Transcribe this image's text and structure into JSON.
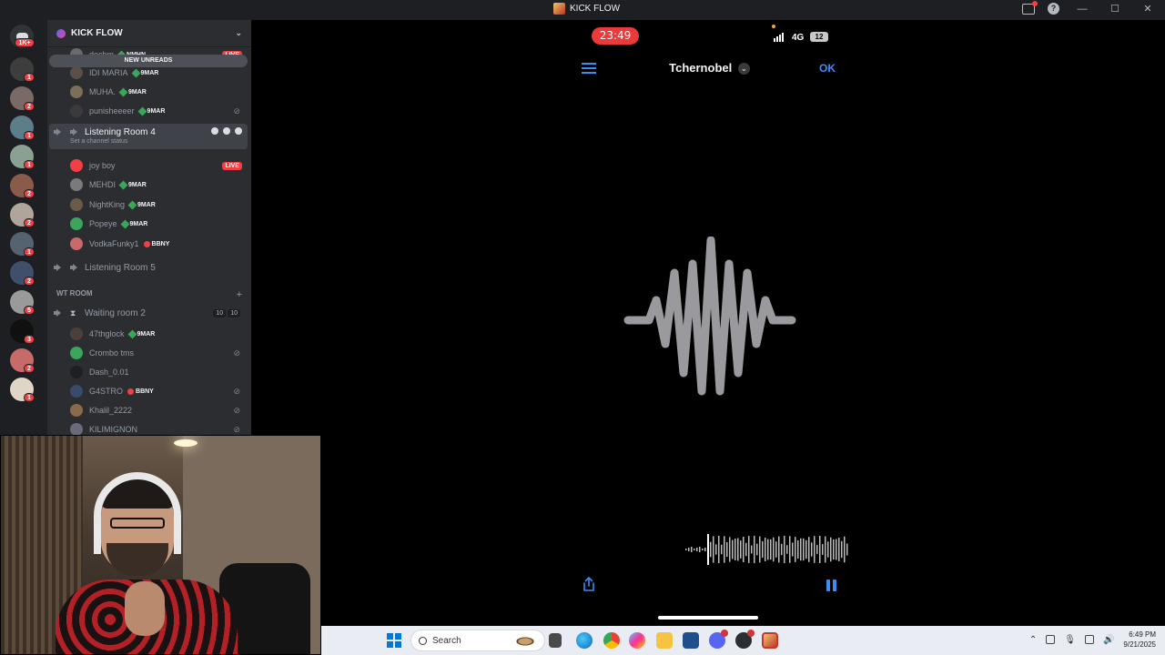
{
  "window": {
    "title": "KICK FLOW"
  },
  "rail": {
    "home_badge": "1K+",
    "servers": [
      {
        "badge": "1",
        "color": "#3d3d3d"
      },
      {
        "badge": "2",
        "color": "#7a6a66"
      },
      {
        "badge": "1",
        "color": "#5c7d8a"
      },
      {
        "badge": "1",
        "color": "#8aa090"
      },
      {
        "badge": "2",
        "color": "#8a5a4a"
      },
      {
        "badge": "2",
        "color": "#b0a59a"
      },
      {
        "badge": "1",
        "color": "#556270"
      },
      {
        "badge": "2",
        "color": "#40506a"
      },
      {
        "badge": "5",
        "color": "#9a9a9a"
      },
      {
        "badge": "3",
        "color": "#101010"
      },
      {
        "badge": "2",
        "color": "#c86a6a"
      },
      {
        "badge": "1",
        "color": "#e0d6c8"
      }
    ]
  },
  "guild": {
    "name": "KICK FLOW"
  },
  "new_unreads": "NEW UNREADS",
  "members_top": [
    {
      "name": "dochm",
      "tag": "NMHN",
      "live": "LIVE",
      "color": "#6a6a6a"
    },
    {
      "name": "IDI MARIA",
      "tag": "9MAR",
      "color": "#5a5048"
    },
    {
      "name": "MUHA.",
      "tag": "9MAR",
      "color": "#7a705a"
    },
    {
      "name": "punisheeeer",
      "tag": "9MAR",
      "color": "#3a3a3a"
    }
  ],
  "voice_room_4": {
    "name": "Listening Room 4",
    "status": "Set a channel status",
    "members": [
      {
        "name": "joy boy",
        "live": "LIVE",
        "color": "#f23f43"
      },
      {
        "name": "MEHDI",
        "tag": "9MAR",
        "color": "#7a7a7a"
      },
      {
        "name": "NightKing",
        "tag": "9MAR",
        "color": "#6a5a4a"
      },
      {
        "name": "Popeye",
        "tag": "9MAR",
        "color": "#3ba55c"
      },
      {
        "name": "VodkaFunky1",
        "tag": "BBNY",
        "color": "#c86a6a"
      }
    ]
  },
  "voice_room_5": {
    "name": "Listening Room 5"
  },
  "category": {
    "name": "WT ROOM"
  },
  "waiting_room": {
    "name": "Waiting room 2",
    "count_a": "10",
    "count_b": "10",
    "members": [
      {
        "name": "47thglock",
        "tag": "9MAR",
        "color": "#4a4038"
      },
      {
        "name": "Crombo tms",
        "color": "#3ba55c"
      },
      {
        "name": "Dash_0.01",
        "color": "#2b2d31"
      },
      {
        "name": "G4STRO",
        "tag": "BBNY",
        "color": "#3a4a6a"
      },
      {
        "name": "Khalil_2222",
        "color": "#8a6a4a"
      },
      {
        "name": "KILIMIGNON",
        "color": "#6a6a7a"
      }
    ]
  },
  "phone": {
    "time": "23:49",
    "network": "4G",
    "battery": "12",
    "recording_title": "Tchernobel",
    "ok_label": "OK"
  },
  "taskbar": {
    "search_placeholder": "Search",
    "time": "6:49 PM",
    "date": "9/21/2025"
  },
  "colors": {
    "accent_blue": "#3a8ef6",
    "recording_red": "#eb3a3a",
    "discord_bg": "#2b2d31"
  }
}
